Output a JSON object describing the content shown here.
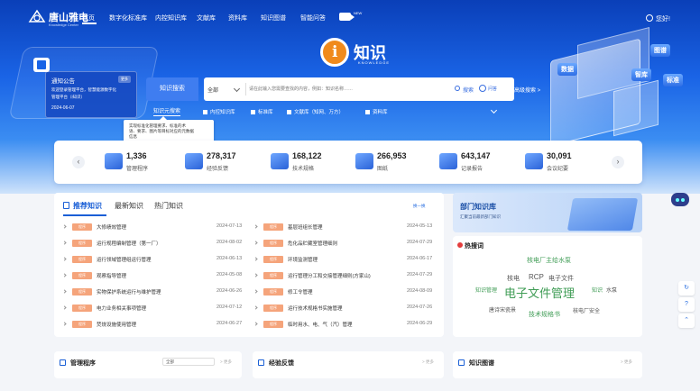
{
  "header": {
    "brand": "唐山雅电",
    "brand_sub": "Knowledge Center",
    "nav": [
      "首页",
      "数字化标准库",
      "内控知识库",
      "文献库",
      "资料库",
      "知识图谱",
      "智能问答"
    ],
    "live_badge": "NEW",
    "user": "您好!"
  },
  "hero": {
    "logo_letter": "i",
    "title": "知识",
    "subtitle": "KNOWLEDGE",
    "deco_tags": [
      "图谱",
      "数据",
      "智库",
      "标准"
    ]
  },
  "notice": {
    "title": "通知公告",
    "badge": "更多",
    "line1": "欢迎登录管理平台，智慧能源数字化",
    "line2": "管理平台（i知识）",
    "date": "2024-06-07"
  },
  "search": {
    "type_label": "知识搜索",
    "scope": "全部",
    "placeholder": "请在此输入您需要查找的内容，例如：知识名称……",
    "search_label": "搜索",
    "ask_label": "问答",
    "advanced": "高级搜索 >",
    "knowledge_btn": "知识元搜索",
    "filters": [
      "内控知识库",
      "标准库",
      "文献库（知网、万方）",
      "资料库"
    ]
  },
  "tooltip": {
    "lines": [
      "实现标准化管理要求、标准的术",
      "语、要求、图片等目标对应的元数据",
      "信息"
    ]
  },
  "stats": [
    {
      "num": "1,336",
      "label": "管理程序"
    },
    {
      "num": "278,317",
      "label": "经验反馈"
    },
    {
      "num": "168,122",
      "label": "技术规格"
    },
    {
      "num": "266,953",
      "label": "图纸"
    },
    {
      "num": "643,147",
      "label": "记录报告"
    },
    {
      "num": "30,091",
      "label": "会议纪要"
    }
  ],
  "recommend": {
    "tabs": [
      "推荐知识",
      "最新知识",
      "热门知识"
    ],
    "refresh": "换一换",
    "badge": "程序",
    "left": [
      {
        "title": "大修绩效管理",
        "date": "2024-07-13"
      },
      {
        "title": "运行规程编制管理（第一厂）",
        "date": "2024-08-02"
      },
      {
        "title": "运行领域管理组运行管理",
        "date": "2024-06-13"
      },
      {
        "title": "观察指导管理",
        "date": "2024-05-08"
      },
      {
        "title": "实物保护系统运行与维护管理",
        "date": "2024-06-26"
      },
      {
        "title": "电力业务相关事项管理",
        "date": "2024-07-12"
      },
      {
        "title": "焚烧设施使用管理",
        "date": "2024-06-27"
      }
    ],
    "right": [
      {
        "title": "基层班组长管理",
        "date": "2024-05-13"
      },
      {
        "title": "危化品贮藏室管理细则",
        "date": "2024-07-29"
      },
      {
        "title": "环境监测管理",
        "date": "2024-06-17"
      },
      {
        "title": "运行管理分工和交接管理细则(方家山)",
        "date": "2024-07-29"
      },
      {
        "title": "修工令管理",
        "date": "2024-08-09"
      },
      {
        "title": "运行技术规格书实施管理",
        "date": "2024-07-26"
      },
      {
        "title": "临时用水、电、气（汽）管理",
        "date": "2024-06-29"
      }
    ]
  },
  "dept": {
    "title": "部门知识库",
    "sub": "汇聚当前最新部门知识"
  },
  "hot": {
    "title": "热搜词",
    "words": [
      "核电厂主给水泵",
      "核电",
      "RCP",
      "电子文件",
      "知识管理",
      "电子文件管理",
      "知识",
      "水泵",
      "唐诗宋瓷景",
      "技术规格书",
      "核电厂安全"
    ]
  },
  "bottom": {
    "b1_title": "管理程序",
    "b1_select": "全部",
    "b2_title": "经验反馈",
    "b3_title": "知识图谱",
    "more": "> 更多"
  },
  "side_tools": [
    "↻",
    "?",
    "⌃"
  ],
  "colors": {
    "primary": "#1a64e6",
    "accent": "#f08a1c",
    "badge": "#f5a47b",
    "hot_red": "#e43d3d"
  }
}
